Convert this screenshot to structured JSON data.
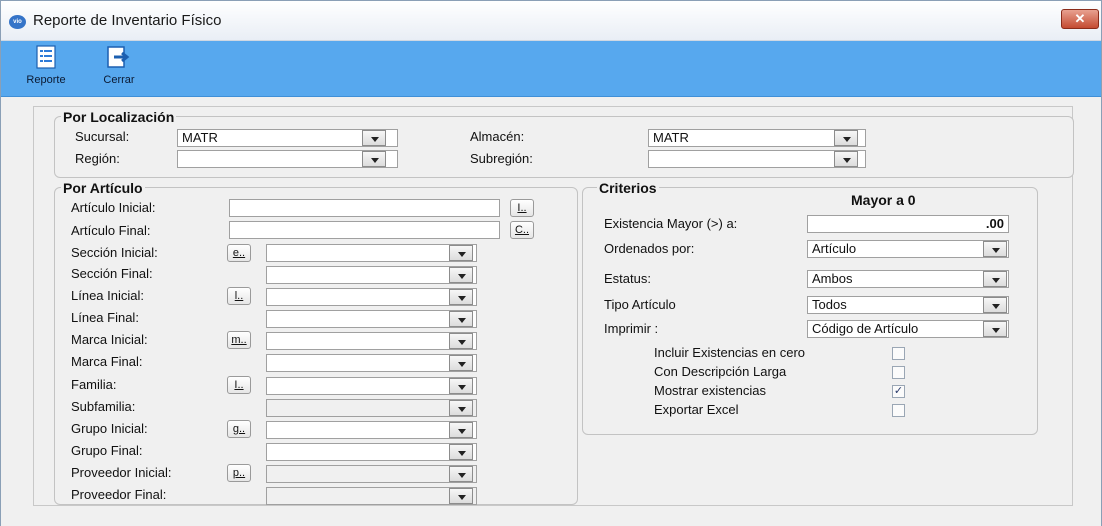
{
  "window": {
    "title": "Reporte de Inventario Físico",
    "app_icon_text": "vio",
    "close_glyph": "✕"
  },
  "toolbar": {
    "reporte_label": "Reporte",
    "cerrar_label": "Cerrar",
    "reporte_icon": "report-icon",
    "cerrar_icon": "exit-icon"
  },
  "localizacion": {
    "title": "Por Localización",
    "sucursal_label": "Sucursal:",
    "sucursal_value": "MATR",
    "region_label": "Región:",
    "region_value": "",
    "almacen_label": "Almacén:",
    "almacen_value": "MATR",
    "subregion_label": "Subregión:",
    "subregion_value": ""
  },
  "articulo": {
    "title": "Por Artículo",
    "rows": [
      {
        "label": "Artículo Inicial:",
        "button": "I..",
        "value": ""
      },
      {
        "label": "Artículo Final:",
        "button": "C..",
        "value": ""
      },
      {
        "label": "Sección Inicial:",
        "button": "e..",
        "value": ""
      },
      {
        "label": "Sección Final:",
        "button": "",
        "value": ""
      },
      {
        "label": "Línea Inicial:",
        "button": "l..",
        "value": ""
      },
      {
        "label": "Línea Final:",
        "button": "",
        "value": ""
      },
      {
        "label": "Marca Inicial:",
        "button": "m..",
        "value": ""
      },
      {
        "label": "Marca Final:",
        "button": "",
        "value": ""
      },
      {
        "label": "Familia:",
        "button": "I..",
        "value": ""
      },
      {
        "label": "Subfamilia:",
        "button": "",
        "value": ""
      },
      {
        "label": "Grupo Inicial:",
        "button": "g..",
        "value": ""
      },
      {
        "label": "Grupo Final:",
        "button": "",
        "value": ""
      },
      {
        "label": "Proveedor Inicial:",
        "button": "p..",
        "value": ""
      },
      {
        "label": "Proveedor Final:",
        "button": "",
        "value": ""
      }
    ]
  },
  "criterios": {
    "title": "Criterios",
    "mayor_header": "Mayor a 0",
    "existencia_label": "Existencia  Mayor (>) a:",
    "existencia_value": ".00",
    "ordenados_label": "Ordenados por:",
    "ordenados_value": "Artículo",
    "estatus_label": "Estatus:",
    "estatus_value": "Ambos",
    "tipo_label": "Tipo Artículo",
    "tipo_value": "Todos",
    "imprimir_label": "Imprimir :",
    "imprimir_value": "Código de Artículo",
    "checks": [
      {
        "label": "Incluir Existencias en cero",
        "checked": false,
        "mark": ""
      },
      {
        "label": "Con Descripción Larga",
        "checked": false,
        "mark": ""
      },
      {
        "label": "Mostrar existencias",
        "checked": true,
        "mark": "✓"
      },
      {
        "label": "Exportar Excel",
        "checked": false,
        "mark": ""
      }
    ]
  }
}
